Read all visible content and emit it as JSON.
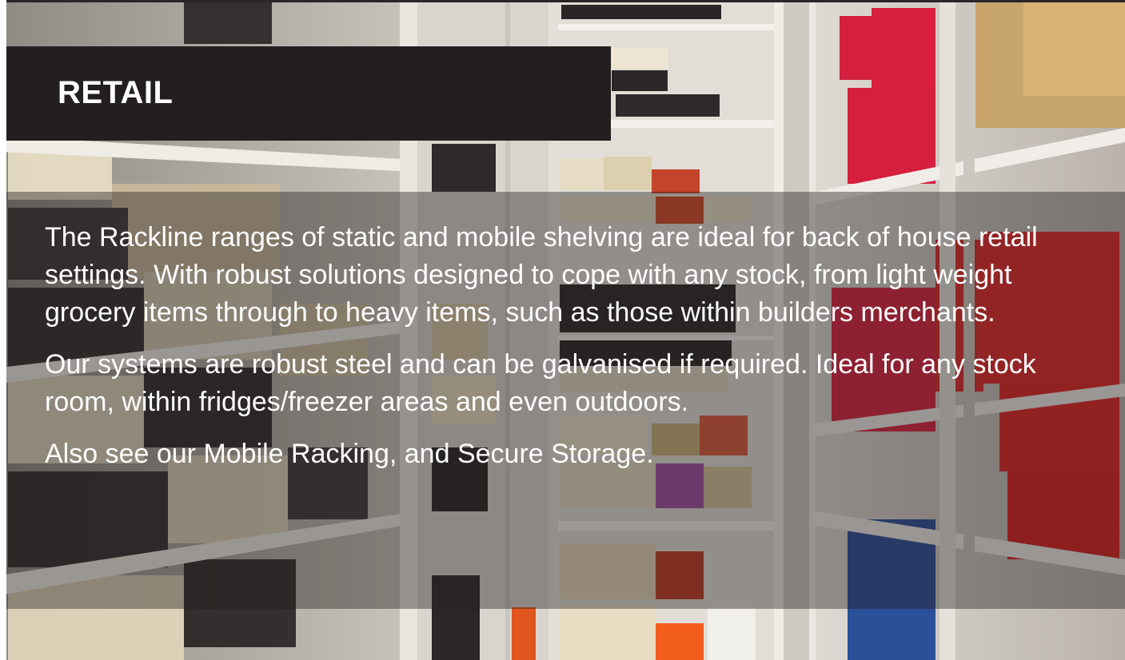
{
  "banner": {
    "title": "RETAIL"
  },
  "content": {
    "paragraphs": [
      "The Rackline ranges of static and mobile shelving are ideal for back of house retail settings. With robust solutions designed to cope with any stock, from light weight grocery items through to heavy items, such as those within builders merchants.",
      "Our systems are robust steel and can be galvanised if required. Ideal for any stock room, within fridges/freezer areas and even outdoors.",
      "Also see our Mobile Racking, and Secure Storage."
    ]
  },
  "colors": {
    "banner_bg": "#231f20",
    "text": "#ffffff",
    "accent_red": "#d8203c",
    "shelf": "#e8e4dc"
  }
}
